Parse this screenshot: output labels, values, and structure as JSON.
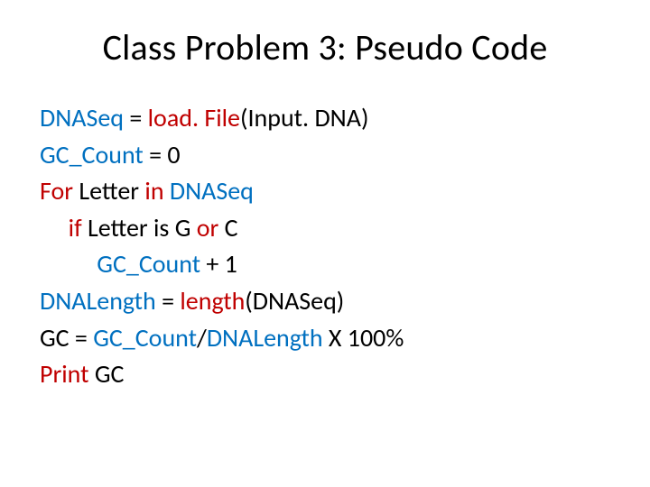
{
  "title": "Class Problem 3: Pseudo Code",
  "code": {
    "l1_a": "DNASeq",
    "l1_b": " = ",
    "l1_c": "load. File",
    "l1_d": "(Input. DNA)",
    "l2_a": "GC_Count",
    "l2_b": " = 0",
    "l3_a": "For ",
    "l3_b": "Letter ",
    "l3_c": "in ",
    "l3_d": "DNASeq",
    "l4_a": "     if ",
    "l4_b": "Letter is G ",
    "l4_c": "or ",
    "l4_d": "C",
    "l5_a": "          GC_Count",
    "l5_b": " + 1",
    "l6_a": "DNALength",
    "l6_b": " = ",
    "l6_c": "length",
    "l6_d": "(DNASeq)",
    "l7_a": "GC = ",
    "l7_b": "GC_Count",
    "l7_c": "/",
    "l7_d": "DNALength",
    "l7_e": " X 100%",
    "l8_a": "Print",
    "l8_b": " GC"
  }
}
